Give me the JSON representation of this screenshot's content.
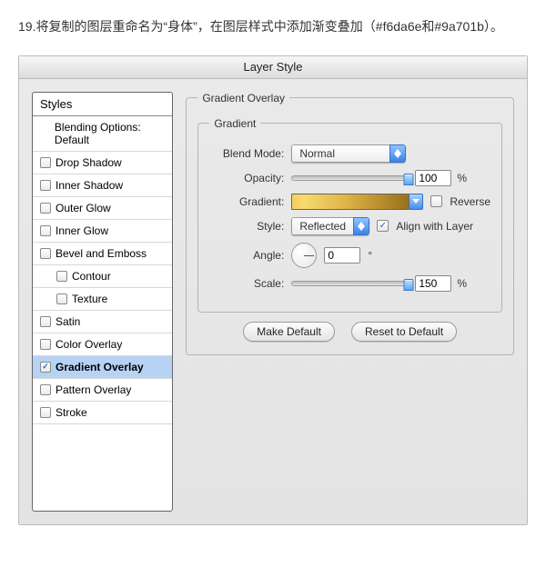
{
  "instruction": "19.将复制的图层重命名为“身体”，在图层样式中添加渐变叠加（#f6da6e和#9a701b）。",
  "dialog": {
    "title": "Layer Style",
    "styles_header": "Styles",
    "blending_label": "Blending Options: Default",
    "items": [
      {
        "label": "Drop Shadow",
        "checked": false
      },
      {
        "label": "Inner Shadow",
        "checked": false
      },
      {
        "label": "Outer Glow",
        "checked": false
      },
      {
        "label": "Inner Glow",
        "checked": false
      },
      {
        "label": "Bevel and Emboss",
        "checked": false
      },
      {
        "label": "Contour",
        "checked": false,
        "sub": true
      },
      {
        "label": "Texture",
        "checked": false,
        "sub": true
      },
      {
        "label": "Satin",
        "checked": false
      },
      {
        "label": "Color Overlay",
        "checked": false
      },
      {
        "label": "Gradient Overlay",
        "checked": true,
        "selected": true,
        "bold": true
      },
      {
        "label": "Pattern Overlay",
        "checked": false
      },
      {
        "label": "Stroke",
        "checked": false
      }
    ]
  },
  "panel": {
    "group_title": "Gradient Overlay",
    "inner_title": "Gradient",
    "blend_mode_label": "Blend Mode:",
    "blend_mode_value": "Normal",
    "opacity_label": "Opacity:",
    "opacity_value": "100",
    "gradient_label": "Gradient:",
    "reverse_label": "Reverse",
    "style_label": "Style:",
    "style_value": "Reflected",
    "align_label": "Align with Layer",
    "align_checked": true,
    "angle_label": "Angle:",
    "angle_value": "0",
    "scale_label": "Scale:",
    "scale_value": "150",
    "make_default": "Make Default",
    "reset_default": "Reset to Default",
    "gradient_stops": [
      "#f6da6e",
      "#9a701b"
    ]
  }
}
